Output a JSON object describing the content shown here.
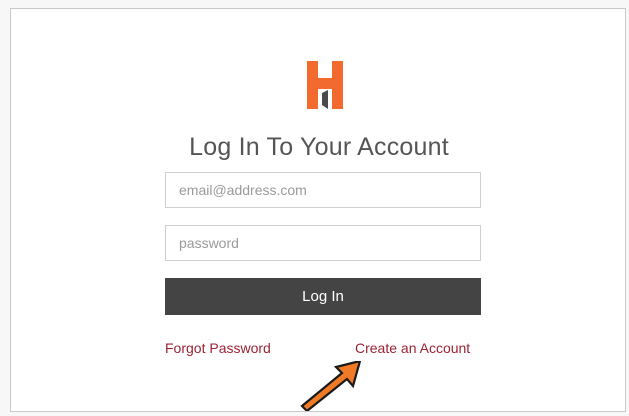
{
  "login": {
    "title": "Log In To Your Account",
    "email_placeholder": "email@address.com",
    "password_placeholder": "password",
    "login_label": "Log In",
    "forgot_label": "Forgot Password",
    "create_label": "Create an Account"
  },
  "icons": {
    "logo": "h-logo-icon",
    "arrow": "arrow-pointer-icon"
  },
  "colors": {
    "brand": "#f26a2e",
    "link": "#9b2335",
    "button": "#444444",
    "arrow": "#f07a25"
  }
}
